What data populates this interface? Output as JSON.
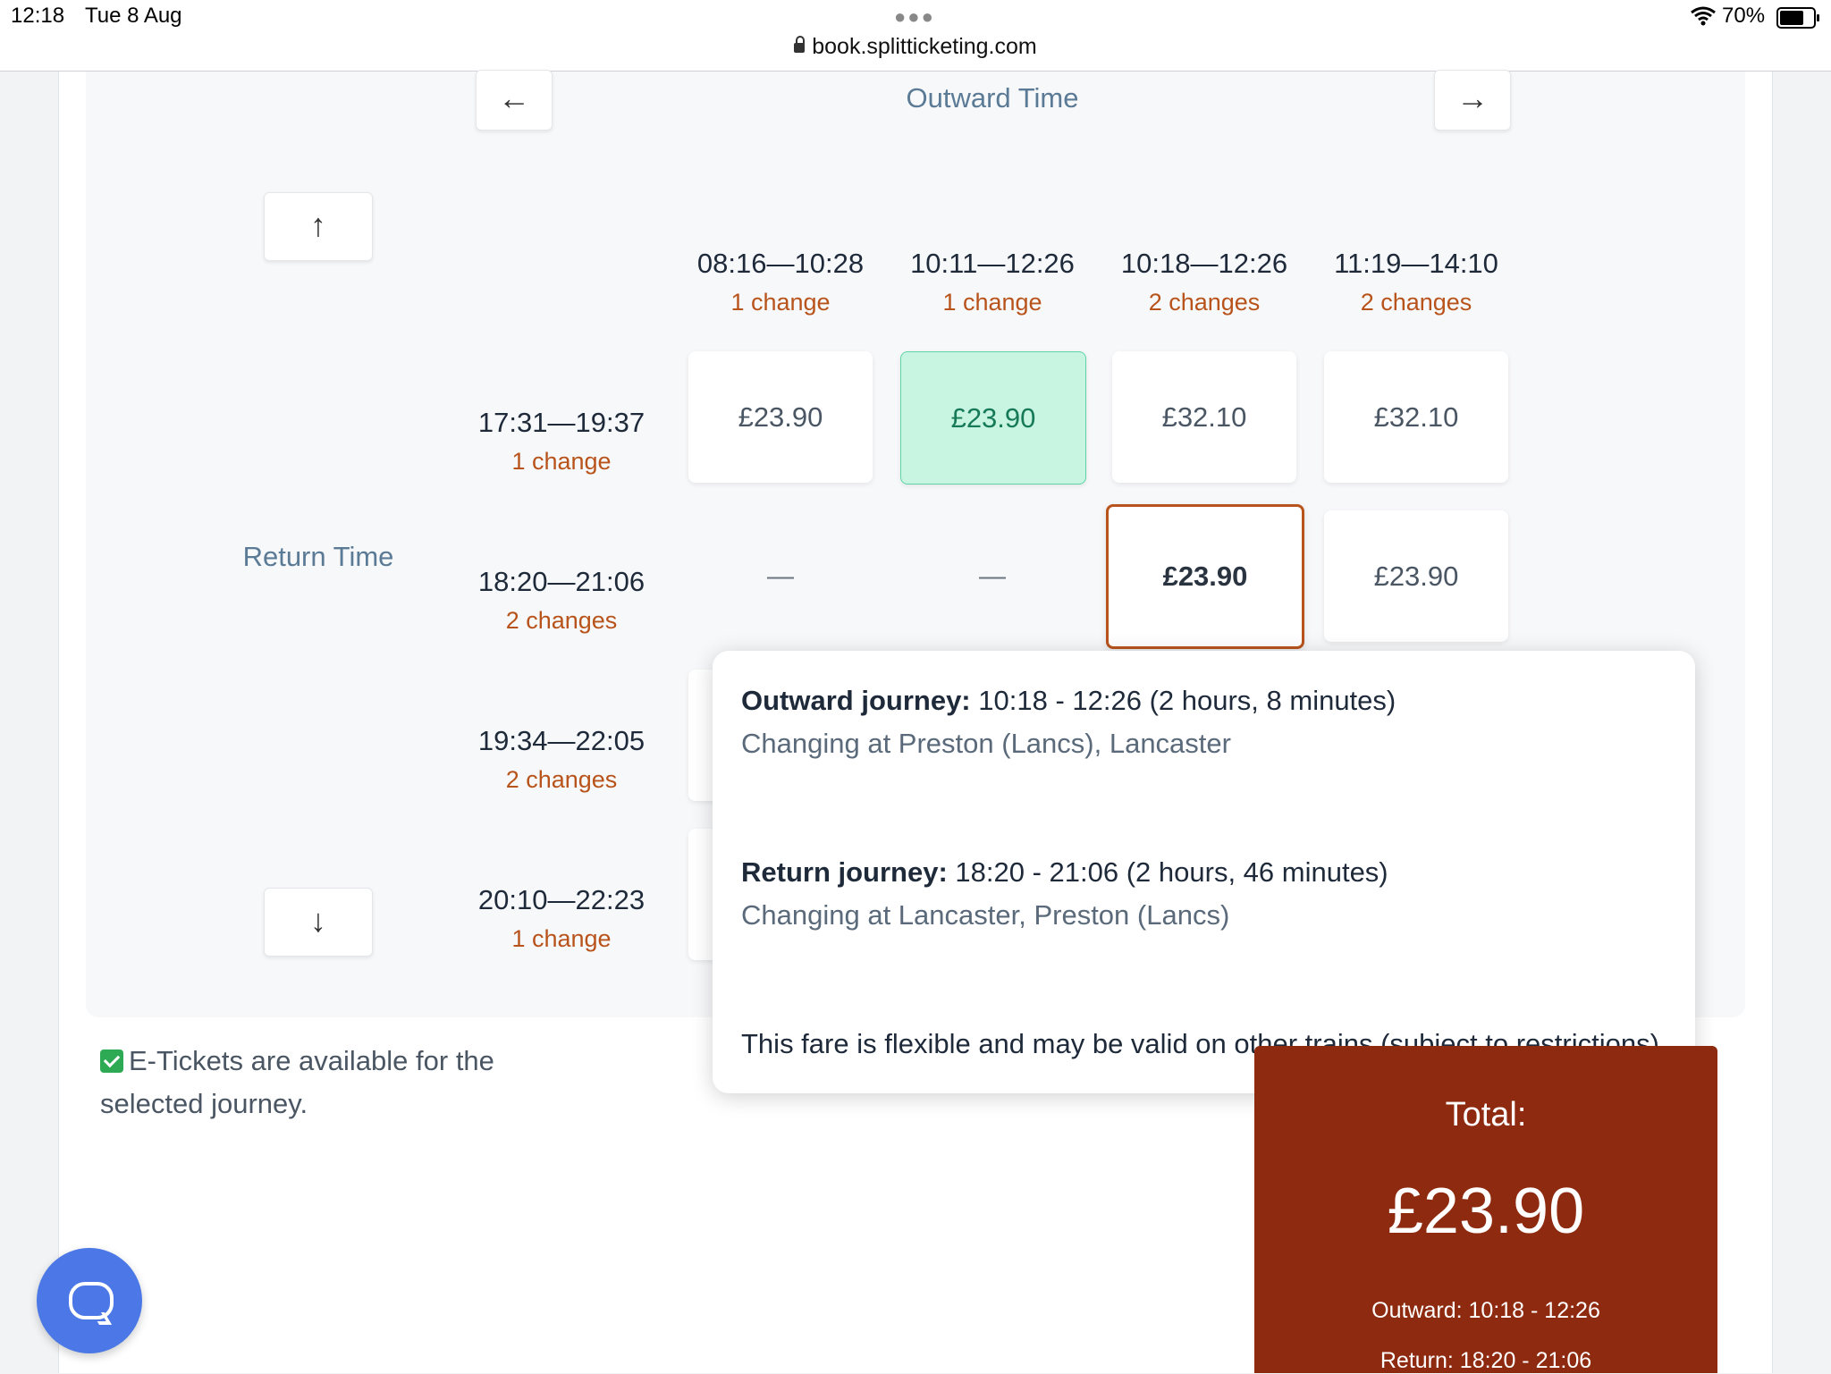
{
  "status_bar": {
    "time": "12:18",
    "date": "Tue 8 Aug",
    "url": "book.splitticketing.com",
    "battery": "70%"
  },
  "nav": {
    "left_arrow": "←",
    "right_arrow": "→",
    "up_arrow": "↑",
    "down_arrow": "↓"
  },
  "outward_title": "Outward Time",
  "return_title": "Return Time",
  "outward_columns": [
    {
      "time": "08:16—10:28",
      "changes": "1 change"
    },
    {
      "time": "10:11—12:26",
      "changes": "1 change"
    },
    {
      "time": "10:18—12:26",
      "changes": "2 changes"
    },
    {
      "time": "11:19—14:10",
      "changes": "2 changes"
    }
  ],
  "return_rows": [
    {
      "time": "17:31—19:37",
      "changes": "1 change"
    },
    {
      "time": "18:20—21:06",
      "changes": "2 changes"
    },
    {
      "time": "19:34—22:05",
      "changes": "2 changes"
    },
    {
      "time": "20:10—22:23",
      "changes": "1 change"
    }
  ],
  "fares": [
    [
      "£23.90",
      "£23.90",
      "£32.10",
      "£32.10"
    ],
    [
      "—",
      "—",
      "£23.90",
      "£23.90"
    ]
  ],
  "tooltip": {
    "outward_label": "Outward journey:",
    "outward_value": " 10:18 - 12:26 (2 hours, 8 minutes)",
    "outward_changes": "Changing at Preston (Lancs), Lancaster",
    "return_label": "Return journey:",
    "return_value": " 18:20 - 21:06 (2 hours, 46 minutes)",
    "return_changes": "Changing at Lancaster, Preston (Lancs)",
    "flex_note": "This fare is flexible and may be valid on other trains (subject to restrictions)"
  },
  "eticket_text": "E-Tickets are available for the selected journey.",
  "total": {
    "label": "Total:",
    "amount": "£23.90",
    "outward": "Outward: 10:18 - 12:26",
    "return": "Return: 18:20 - 21:06"
  },
  "colors": {
    "selected_border": "#b8531b",
    "cheapest_fill": "#c8f5e2",
    "total_bg": "#8e2a0f",
    "chat_button": "#4b78e6"
  }
}
